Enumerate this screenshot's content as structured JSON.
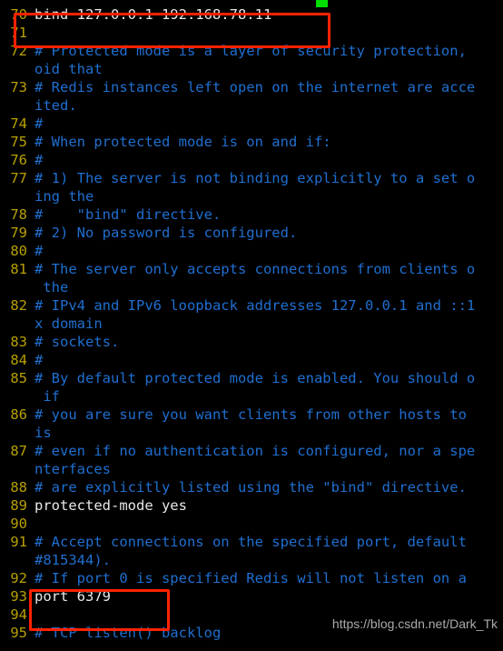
{
  "app": {
    "kind": "terminal-text-editor",
    "file_kind": "redis-configuration-file"
  },
  "colors": {
    "background": "#000000",
    "comment_text": "#1f6fd0",
    "code_text": "#e8e8e8",
    "line_number": "#b8a000",
    "annotation_box": "#ff2200",
    "cursor_block": "#00e000",
    "watermark_text": "#b9b9b9"
  },
  "cursor": {
    "name": "green-cursor-block"
  },
  "watermark": {
    "text": "https://blog.csdn.net/Dark_Tk"
  },
  "annotations": [
    {
      "name": "bind-directive-highlight",
      "targets": "line 70 bind 127.0.0.1 192.168.78.11"
    },
    {
      "name": "port-directive-highlight",
      "targets": "lines 92-94 port 6379"
    }
  ],
  "editor": {
    "rows": [
      {
        "num": "",
        "text": "--------",
        "style": "comment"
      },
      {
        "num": "70",
        "text": "bind 127.0.0.1 192.168.78.11",
        "style": "code"
      },
      {
        "num": "71",
        "text": "",
        "style": "code"
      },
      {
        "num": "72",
        "text": "# Protected mode is a layer of security protection,",
        "style": "comment"
      },
      {
        "num": "",
        "text": "oid that",
        "style": "comment"
      },
      {
        "num": "73",
        "text": "# Redis instances left open on the internet are acce",
        "style": "comment"
      },
      {
        "num": "",
        "text": "ited.",
        "style": "comment"
      },
      {
        "num": "74",
        "text": "#",
        "style": "comment"
      },
      {
        "num": "75",
        "text": "# When protected mode is on and if:",
        "style": "comment"
      },
      {
        "num": "76",
        "text": "#",
        "style": "comment"
      },
      {
        "num": "77",
        "text": "# 1) The server is not binding explicitly to a set o",
        "style": "comment"
      },
      {
        "num": "",
        "text": "ing the",
        "style": "comment"
      },
      {
        "num": "78",
        "text": "#    \"bind\" directive.",
        "style": "comment"
      },
      {
        "num": "79",
        "text": "# 2) No password is configured.",
        "style": "comment"
      },
      {
        "num": "80",
        "text": "#",
        "style": "comment"
      },
      {
        "num": "81",
        "text": "# The server only accepts connections from clients o",
        "style": "comment"
      },
      {
        "num": "",
        "text": " the",
        "style": "comment"
      },
      {
        "num": "82",
        "text": "# IPv4 and IPv6 loopback addresses 127.0.0.1 and ::1",
        "style": "comment"
      },
      {
        "num": "",
        "text": "x domain",
        "style": "comment"
      },
      {
        "num": "83",
        "text": "# sockets.",
        "style": "comment"
      },
      {
        "num": "84",
        "text": "#",
        "style": "comment"
      },
      {
        "num": "85",
        "text": "# By default protected mode is enabled. You should o",
        "style": "comment"
      },
      {
        "num": "",
        "text": " if",
        "style": "comment"
      },
      {
        "num": "86",
        "text": "# you are sure you want clients from other hosts to",
        "style": "comment"
      },
      {
        "num": "",
        "text": "is",
        "style": "comment"
      },
      {
        "num": "87",
        "text": "# even if no authentication is configured, nor a spe",
        "style": "comment"
      },
      {
        "num": "",
        "text": "nterfaces",
        "style": "comment"
      },
      {
        "num": "88",
        "text": "# are explicitly listed using the \"bind\" directive.",
        "style": "comment"
      },
      {
        "num": "89",
        "text": "protected-mode yes",
        "style": "code"
      },
      {
        "num": "90",
        "text": "",
        "style": "code"
      },
      {
        "num": "91",
        "text": "# Accept connections on the specified port, default",
        "style": "comment"
      },
      {
        "num": "",
        "text": "#815344).",
        "style": "comment"
      },
      {
        "num": "92",
        "text": "# If port 0 is specified Redis will not listen on a",
        "style": "comment"
      },
      {
        "num": "93",
        "text": "port 6379",
        "style": "code"
      },
      {
        "num": "94",
        "text": "",
        "style": "code"
      },
      {
        "num": "95",
        "text": "# TCP listen() backlog",
        "style": "comment"
      }
    ]
  }
}
